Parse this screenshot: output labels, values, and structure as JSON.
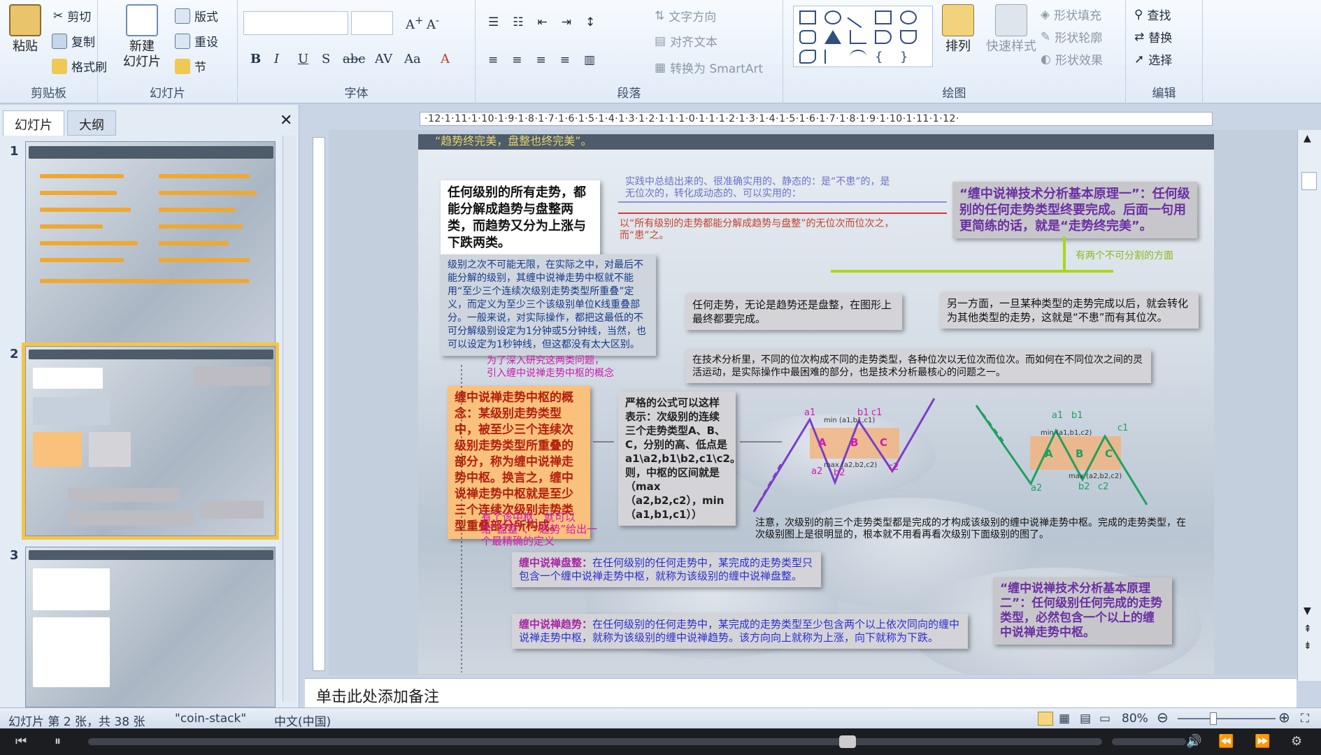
{
  "ribbon": {
    "clipboard": {
      "paste": "粘贴",
      "cut": "剪切",
      "copy": "复制",
      "painter": "格式刷",
      "label": "剪贴板"
    },
    "slides": {
      "new_slide": "新建",
      "new_slide2": "幻灯片",
      "layout": "版式",
      "reset": "重设",
      "section": "节",
      "label": "幻灯片"
    },
    "font": {
      "label": "字体",
      "bold": "B",
      "italic": "I",
      "underline": "U",
      "shadow": "S",
      "strike": "abc",
      "spacing": "AV",
      "case": "Aa",
      "color": "A"
    },
    "paragraph": {
      "text_direction": "文字方向",
      "align_text": "对齐文本",
      "smartart": "转换为 SmartArt",
      "label": "段落"
    },
    "drawing": {
      "arrange": "排列",
      "quick_styles": "快速样式",
      "fill": "形状填充",
      "outline": "形状轮廓",
      "effects": "形状效果",
      "label": "绘图"
    },
    "editing": {
      "find": "查找",
      "replace": "替换",
      "select": "选择",
      "label": "编辑"
    }
  },
  "panel": {
    "tab_slides": "幻灯片",
    "tab_outline": "大纲",
    "close": "✕",
    "slides": [
      {
        "num": "1"
      },
      {
        "num": "2"
      },
      {
        "num": "3"
      }
    ]
  },
  "ruler": {
    "text": "·12·1·11·1·10·1·9·1·8·1·7·1·6·1·5·1·4·1·3·1·2·1·1·1·0·1·1·1·2·1·3·1·4·1·5·1·6·1·7·1·8·1·9·1·10·1·11·1·12·"
  },
  "slide": {
    "top_banner": "“趋势终完美，盘整也终完美”。",
    "box_trend": "任何级别的所有走势，都能分解成趋势与盘整两类，而趋势又分为上涨与下跌两类。",
    "note_top1": "实践中总结出来的、很准确实用的、静态的：是“不患”的，是无位次的，转化成动态的、可以实用的：",
    "note_top2": "以“所有级别的走势都能分解成趋势与盘整”的无位次而位次之，而“患”之。",
    "box_principle": "“缠中说禅技术分析基本原理一”：任何级别的任何走势类型终要完成。后面一句用更简练的话，就是“走势终完美”。",
    "note_two_aspects": "有两个不可分割的方面",
    "box_level": "级别之次不可能无限，在实际之中，对最后不能分解的级别，其缠中说禅走势中枢就不能用“至少三个连续次级别走势类型所重叠”定义，而定义为至少三个该级别单位K线重叠部分。一般来说，对实际操作，都把这最低的不可分解级别设定为1分钟或5分钟线，当然，也可以设定为1秒钟线，但这都没有太大区别。",
    "box_any_trend": "任何走势，无论是趋势还是盘整，在图形上最终都要完成。",
    "box_other": "另一方面，一旦某种类型的走势完成以后，就会转化为其他类型的走势，这就是“不患”而有其位次。",
    "box_tech": "在技术分析里，不同的位次构成不同的走势类型，各种位次以无位次而位次。而如何在不同位次之间的灵活运动，是实际操作中最困难的部分，也是技术分析最核心的问题之一。",
    "note_intro1": "为了深入研究这两类问题，",
    "note_intro2": "引入缠中说禅走势中枢的概念",
    "box_center": "缠中说禅走势中枢的概念：某级别走势类型中，被至少三个连续次级别走势类型所重叠的部分，称为缠中说禅走势中枢。换言之，缠中说禅走势中枢就是至少三个连续次级别走势类型重叠部分所构成。",
    "box_formula": "严格的公式可以这样表示：次级别的连续三个走势类型A、B、C，分别的高、低点是a1\\a2,b1\\b2,c1\\c2。则，中枢的区间就是（max（a2,b2,c2），min（a1,b1,c1））",
    "note_define": "有了该中枢，就可以给“盘整”、“趋势”给出一个最精确的定义",
    "note_attention": "注意，次级别的前三个走势类型都是完成的才构成该级别的缠中说禅走势中枢。完成的走势类型，在次级别图上是很明显的，根本就不用看再看次级别下面级别的图了。",
    "box_consolidation_title": "缠中说禅盘整：",
    "box_consolidation": "在任何级别的任何走势中，某完成的走势类型只包含一个缠中说禅走势中枢，就称为该级别的缠中说禅盘整。",
    "box_trend2_title": "缠中说禅趋势：",
    "box_trend2": "在任何级别的任何走势中，某完成的走势类型至少包含两个以上依次同向的缠中说禅走势中枢，就称为该级别的缠中说禅趋势。该方向向上就称为上涨，向下就称为下跌。",
    "box_principle2": "“缠中说禅技术分析基本原理二”：任何级别任何完成的走势类型，必然包含一个以上的缠中说禅走势中枢。",
    "chart_labels": {
      "a1": "a1",
      "a2": "a2",
      "b1": "b1",
      "b2": "b2",
      "c1": "c1",
      "c2": "c2",
      "A": "A",
      "B": "B",
      "C": "C",
      "min": "min (a1,b1,c1)",
      "max": "max (a2,b2,c2)",
      "min2": "min (a1,b1,c2)",
      "max2": "max (a2,b2,c2)"
    }
  },
  "notes": {
    "placeholder": "单击此处添加备注"
  },
  "status": {
    "slide_info": "幻灯片 第 2 张，共 38 张",
    "theme": "\"coin-stack\"",
    "language": "中文(中国)",
    "zoom": "80%"
  }
}
